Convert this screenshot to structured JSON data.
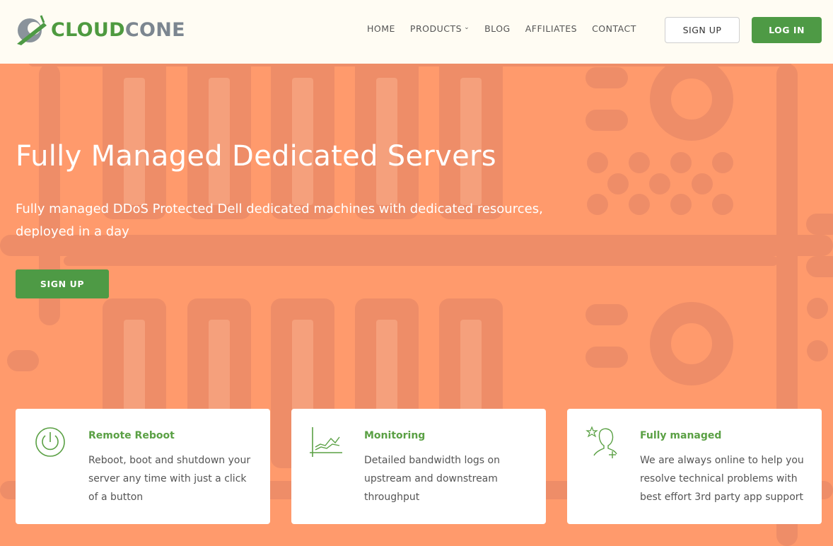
{
  "brand": {
    "name_part1": "CLOUD",
    "name_part2": "CONE",
    "green": "#4e9a45",
    "orange": "#ff9a6c"
  },
  "nav": {
    "items": [
      {
        "label": "HOME"
      },
      {
        "label": "PRODUCTS",
        "has_dropdown": true
      },
      {
        "label": "BLOG"
      },
      {
        "label": "AFFILIATES"
      },
      {
        "label": "CONTACT"
      }
    ],
    "signup_label": "SIGN UP",
    "login_label": "LOG IN"
  },
  "hero": {
    "title": "Fully Managed Dedicated Servers",
    "subtitle": "Fully managed DDoS Protected Dell dedicated machines with dedicated resources, deployed in a day",
    "cta_label": "SIGN UP"
  },
  "features": [
    {
      "icon": "power-icon",
      "title": "Remote Reboot",
      "description": "Reboot, boot and shutdown your server any time with just a click of a button"
    },
    {
      "icon": "chart-icon",
      "title": "Monitoring",
      "description": "Detailed bandwidth logs on upstream and downstream throughput"
    },
    {
      "icon": "support-person-icon",
      "title": "Fully managed",
      "description": "We are always online to help you resolve technical problems with best effort 3rd party app support"
    }
  ]
}
